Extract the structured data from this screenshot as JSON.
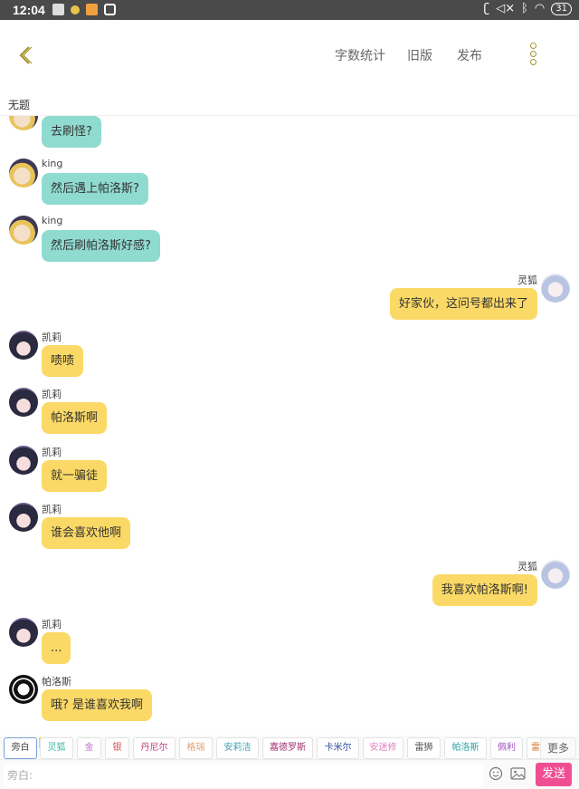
{
  "status_bar": {
    "time": "12:04",
    "battery": "31"
  },
  "toolbar": {
    "word_count": "字数统计",
    "old_version": "旧版",
    "publish": "发布"
  },
  "document": {
    "title": "无题"
  },
  "chat": [
    {
      "side": "left",
      "speaker": "",
      "text": "去刷怪?",
      "color": "teal",
      "avatar": "king"
    },
    {
      "side": "left",
      "speaker": "king",
      "text": "然后遇上帕洛斯?",
      "color": "teal",
      "avatar": "king"
    },
    {
      "side": "left",
      "speaker": "king",
      "text": "然后刷帕洛斯好感?",
      "color": "teal",
      "avatar": "king"
    },
    {
      "side": "right",
      "speaker": "灵狐",
      "text": "好家伙，这问号都出来了",
      "color": "yellow",
      "avatar": "linghu"
    },
    {
      "side": "left",
      "speaker": "凯莉",
      "text": "啧啧",
      "color": "yellow",
      "avatar": "kaili"
    },
    {
      "side": "left",
      "speaker": "凯莉",
      "text": "帕洛斯啊",
      "color": "yellow",
      "avatar": "kaili"
    },
    {
      "side": "left",
      "speaker": "凯莉",
      "text": "就一骗徒",
      "color": "yellow",
      "avatar": "kaili"
    },
    {
      "side": "left",
      "speaker": "凯莉",
      "text": "谁会喜欢他啊",
      "color": "yellow",
      "avatar": "kaili"
    },
    {
      "side": "right",
      "speaker": "灵狐",
      "text": "我喜欢帕洛斯啊!",
      "color": "yellow",
      "avatar": "linghu"
    },
    {
      "side": "left",
      "speaker": "凯莉",
      "text": "...",
      "color": "yellow",
      "avatar": "kaili"
    },
    {
      "side": "left",
      "speaker": "帕洛斯",
      "text": "哦? 是谁喜欢我啊",
      "color": "yellow",
      "avatar": "paluosi"
    }
  ],
  "characters": [
    {
      "label": "旁白",
      "color": "#444444"
    },
    {
      "label": "灵狐",
      "color": "#3fb8a8"
    },
    {
      "label": "金",
      "color": "#c070d0"
    },
    {
      "label": "银",
      "color": "#d05050"
    },
    {
      "label": "丹尼尔",
      "color": "#c04080"
    },
    {
      "label": "格瑞",
      "color": "#e0a070"
    },
    {
      "label": "安莉洁",
      "color": "#40a0b0"
    },
    {
      "label": "嘉德罗斯",
      "color": "#a03070"
    },
    {
      "label": "卡米尔",
      "color": "#3050a0"
    },
    {
      "label": "安迷修",
      "color": "#e080c0"
    },
    {
      "label": "雷狮",
      "color": "#555555"
    },
    {
      "label": "帕洛斯",
      "color": "#30a0a0"
    },
    {
      "label": "佩利",
      "color": "#a050c0"
    },
    {
      "label": "雷",
      "color": "#d08030"
    }
  ],
  "chips_more": "更多",
  "chip_add": "+",
  "input": {
    "placeholder": "旁白:"
  },
  "send_label": "发送"
}
